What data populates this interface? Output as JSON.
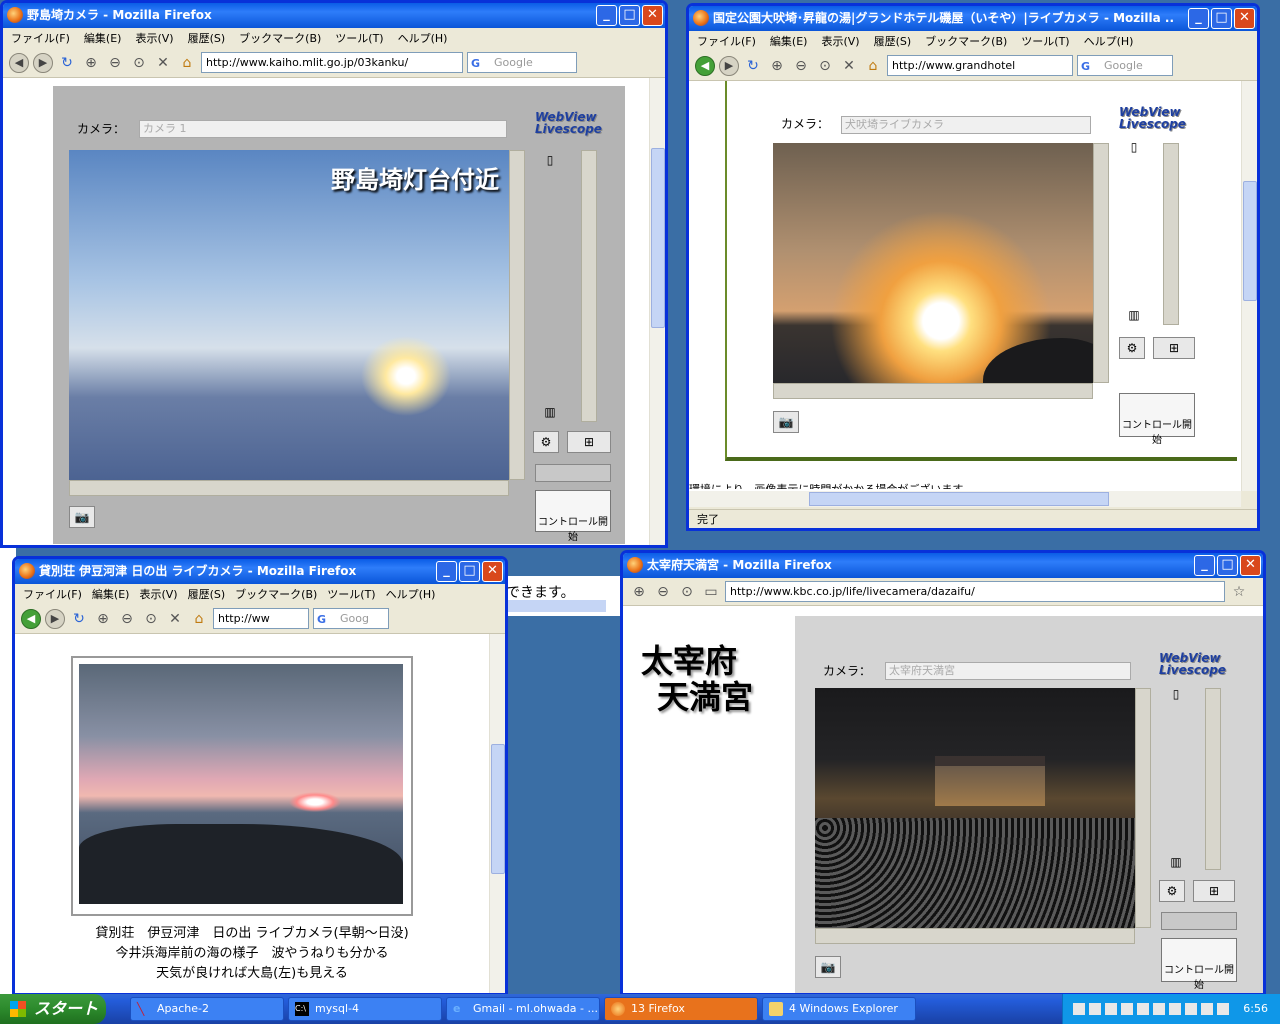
{
  "colors": {
    "xp_blue": "#0831d9",
    "desktop": "#3a6ea5",
    "taskbar": "#245ddb"
  },
  "icons": [
    "firefox-icon",
    "back-icon",
    "forward-icon",
    "reload-icon",
    "stop-icon",
    "home-icon",
    "zoom-in-icon",
    "zoom-out-icon",
    "star-icon",
    "search-icon",
    "camera-icon",
    "snapshot-icon",
    "minimize-icon",
    "maximize-icon",
    "close-icon"
  ],
  "w1": {
    "title": "野島埼カメラ - Mozilla Firefox",
    "menu": [
      "ファイル(F)",
      "編集(E)",
      "表示(V)",
      "履歴(S)",
      "ブックマーク(B)",
      "ツール(T)",
      "ヘルプ(H)"
    ],
    "url": "http://www.kaiho.mlit.go.jp/03kanku/",
    "search_placeholder": "Google",
    "camera_label": "カメラ：",
    "camera_value": "カメラ 1",
    "logo1": "WebView",
    "logo2": "Livescope",
    "overlay": "野島埼灯台付近",
    "control_button": "コントロール開始"
  },
  "w2": {
    "title": "国定公園大吠埼･昇龍の湯|グランドホテル磯屋（いそや）|ライブカメラ - Mozilla ...",
    "menu": [
      "ファイル(F)",
      "編集(E)",
      "表示(V)",
      "履歴(S)",
      "ブックマーク(B)",
      "ツール(T)",
      "ヘルプ(H)"
    ],
    "url": "http://www.grandhotel",
    "search_placeholder": "Google",
    "camera_label": "カメラ：",
    "camera_value": "犬吠埼ライブカメラ",
    "logo1": "WebView",
    "logo2": "Livescope",
    "control_button": "コントロール開始",
    "cut_text": "環境により、画像表示に時間がかかる場合がございます。",
    "status": "完了"
  },
  "w3": {
    "title": "貸別荘 伊豆河津 日の出 ライブカメラ - Mozilla Firefox",
    "menu": [
      "ファイル(F)",
      "編集(E)",
      "表示(V)",
      "履歴(S)",
      "ブックマーク(B)",
      "ツール(T)",
      "ヘルプ(H)"
    ],
    "url": "http://ww",
    "search_placeholder": "Goog",
    "caption1": "貸別荘　伊豆河津　日の出 ライブカメラ(早朝～日没)",
    "caption2": "今井浜海岸前の海の様子　波やうねりも分かる",
    "caption3": "天気が良ければ大島(左)も見える"
  },
  "w4": {
    "title": "太宰府天満宮 - Mozilla Firefox",
    "url": "http://www.kbc.co.jp/life/livecamera/dazaifu/",
    "heading1": "太宰府",
    "heading2": "天満宮",
    "camera_label": "カメラ：",
    "camera_value": "太宰府天満宮",
    "logo1": "WebView",
    "logo2": "Livescope",
    "control_button": "コントロール開始"
  },
  "behind_text": "できます。",
  "taskbar": {
    "start": "スタート",
    "items": [
      "Apache-2",
      "mysql-4",
      "Gmail - ml.ohwada - ...",
      "13 Firefox",
      "4 Windows Explorer"
    ],
    "clock": "6:56"
  }
}
